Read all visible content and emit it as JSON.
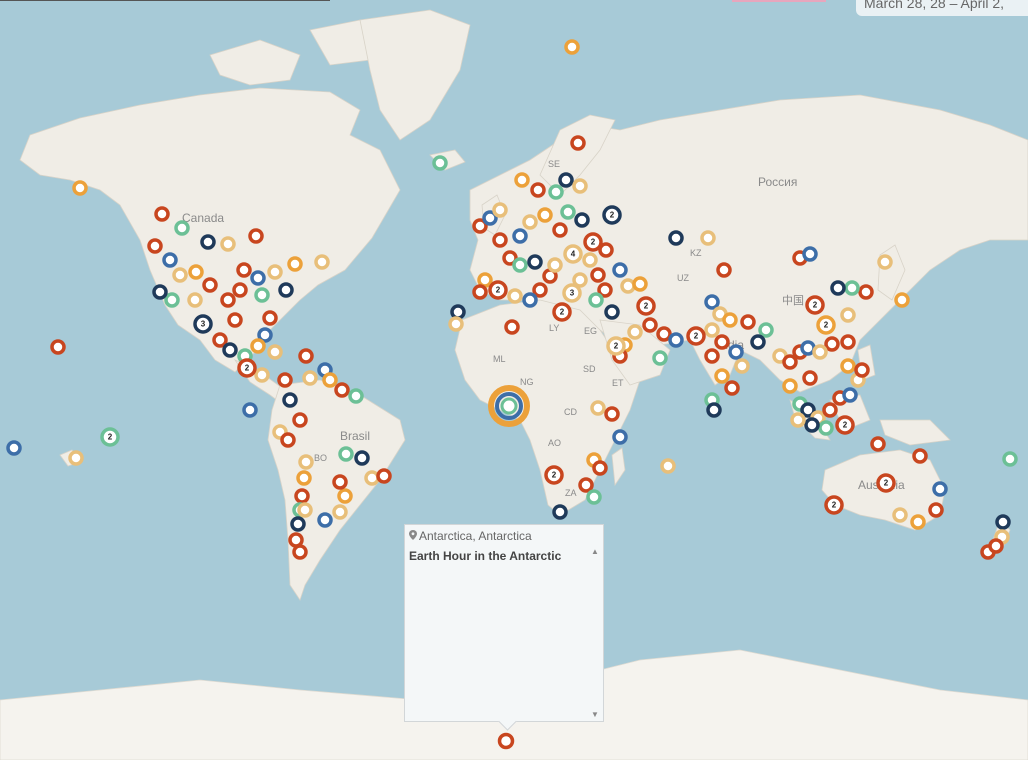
{
  "header": {
    "date_range": "March 28, 28 – April 2,"
  },
  "colors": {
    "ocean": "#a7cad7",
    "land": "#f0ede6",
    "marker_red": "#c8461f",
    "marker_orange": "#eca13a",
    "marker_tan": "#e8bf7a",
    "marker_navy": "#1f3a5a",
    "marker_blue": "#3d6ea8",
    "marker_green": "#6cc096"
  },
  "map_labels": [
    "Canada",
    "Brasil",
    "Россия",
    "中国",
    "India",
    "Australia",
    "SE",
    "KZ",
    "UZ",
    "LY",
    "EG",
    "ML",
    "NG",
    "SD",
    "ET",
    "CD",
    "AO",
    "BO",
    "ZA"
  ],
  "cluster_counts": [
    "2",
    "2",
    "2",
    "3",
    "2",
    "4",
    "3",
    "2",
    "2",
    "2",
    "2",
    "2",
    "2",
    "2",
    "2",
    "2",
    "2",
    "2"
  ],
  "popup": {
    "location": "Antarctica, Antarctica",
    "title": "Earth Hour in the Antarctic",
    "scroll_up_icon": "triangle-up",
    "scroll_down_icon": "triangle-down"
  }
}
